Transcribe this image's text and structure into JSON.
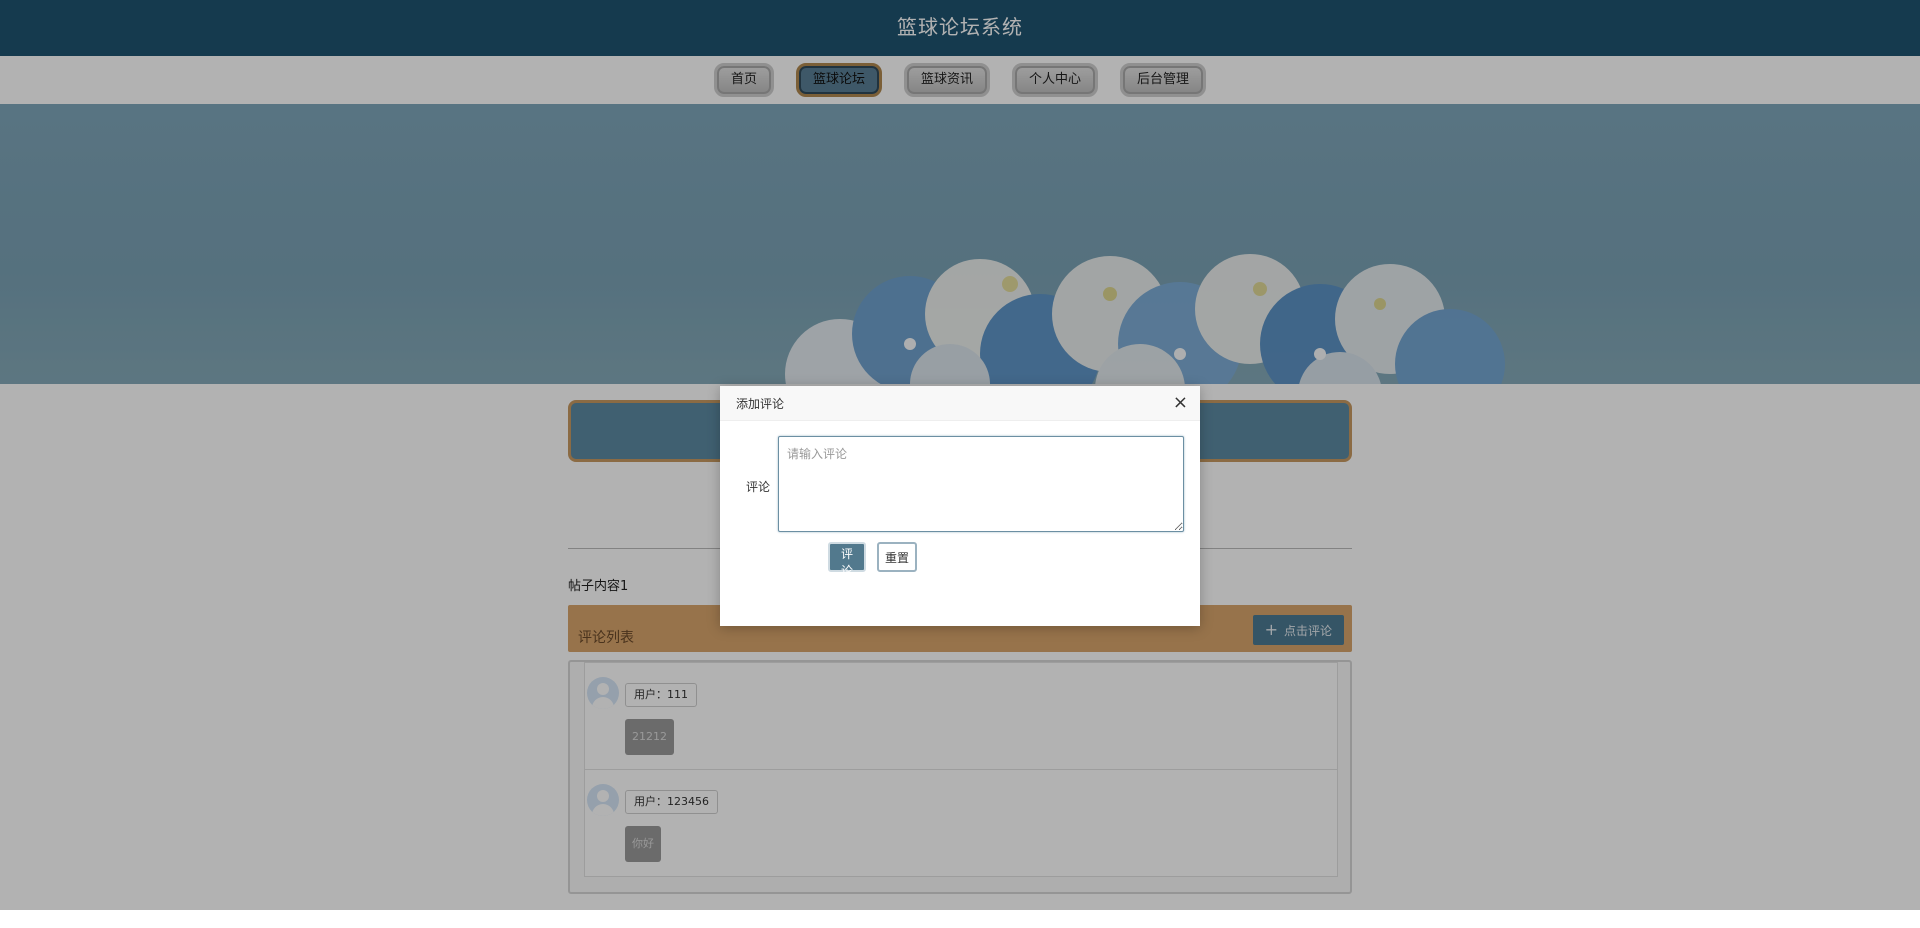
{
  "app": {
    "title": "篮球论坛系统"
  },
  "nav": {
    "items": [
      {
        "label": "首页",
        "active": false
      },
      {
        "label": "篮球论坛",
        "active": true
      },
      {
        "label": "篮球资讯",
        "active": false
      },
      {
        "label": "个人中心",
        "active": false
      },
      {
        "label": "后台管理",
        "active": false
      }
    ]
  },
  "post": {
    "content": "帖子内容1"
  },
  "comments_section": {
    "title": "评论列表",
    "add_button_label": "点击评论",
    "add_button_icon": "plus-icon",
    "items": [
      {
        "user": "用户：111",
        "text": "21212"
      },
      {
        "user": "用户：123456",
        "text": "你好"
      }
    ]
  },
  "modal": {
    "title": "添加评论",
    "close_label": "×",
    "field_label": "评论",
    "input_placeholder": "请输入评论",
    "input_value": "",
    "submit_label": "评论",
    "reset_label": "重置"
  },
  "colors": {
    "header": "#1f5370",
    "accent": "#52798d",
    "comment_bar": "#d8a56c"
  }
}
